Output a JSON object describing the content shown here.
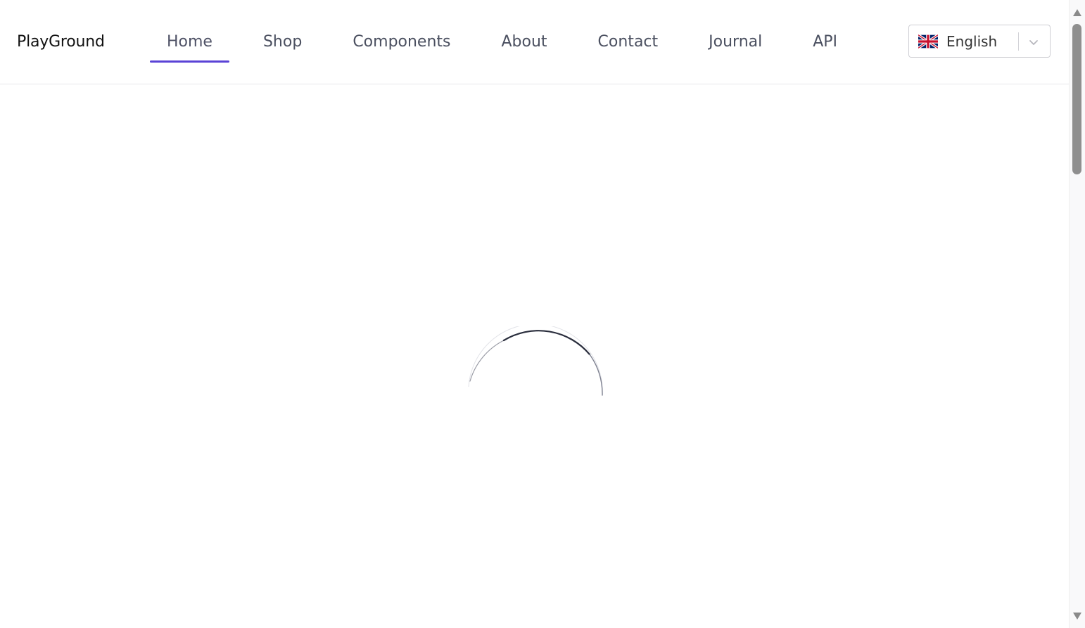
{
  "header": {
    "brand": "PlayGround",
    "nav": [
      {
        "label": "Home",
        "active": true
      },
      {
        "label": "Shop",
        "active": false
      },
      {
        "label": "Components",
        "active": false
      },
      {
        "label": "About",
        "active": false
      },
      {
        "label": "Contact",
        "active": false
      },
      {
        "label": "Journal",
        "active": false
      },
      {
        "label": "API",
        "active": false
      }
    ],
    "language": {
      "selected": "English",
      "flag_icon": "uk-flag-icon",
      "toggle_icon": "chevron-down-icon"
    }
  },
  "main": {
    "loading_indicator": "loading-spinner"
  },
  "colors": {
    "accent": "#5a43d6",
    "nav_text": "#4b5060",
    "brand_text": "#111111",
    "spinner": "#2a2e3d"
  }
}
